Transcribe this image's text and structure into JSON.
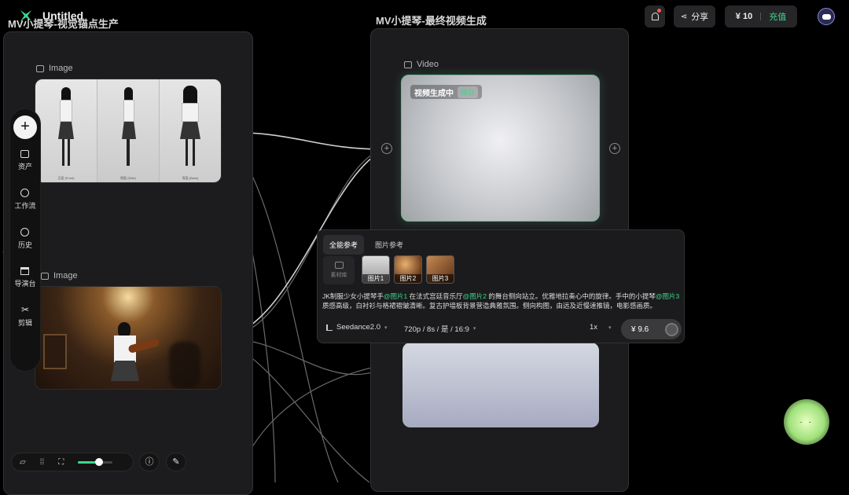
{
  "app": {
    "title": "Untitled"
  },
  "groups": {
    "left_title": "MV小提琴-视觉锚点生产",
    "right_title": "MV小提琴-最终视频生成"
  },
  "nodes": {
    "image1_label": "Image",
    "image2_label": "Image",
    "video_label": "Video",
    "video_status": "视频生成中",
    "video_status_badge": "排队",
    "sheet_captions": [
      "正面 (Front)",
      "侧面 (Side)",
      "背面 (Back)"
    ]
  },
  "header": {
    "share_label": "分享",
    "balance": "¥ 10",
    "recharge_label": "充值"
  },
  "sidebar": {
    "items": [
      {
        "label": "资产",
        "icon": "asset-box-icon"
      },
      {
        "label": "工作流",
        "icon": "workflow-icon"
      },
      {
        "label": "历史",
        "icon": "clock-icon"
      },
      {
        "label": "导演台",
        "icon": "clapper-icon"
      },
      {
        "label": "剪辑",
        "icon": "scissors-icon"
      }
    ]
  },
  "prompt_panel": {
    "tabs": [
      "全能参考",
      "图片参考"
    ],
    "material_label": "素材库",
    "thumbs": [
      "图片1",
      "图片2",
      "图片3"
    ],
    "text_parts": {
      "p1": "JK制服少女小提琴手",
      "m1": "@图片1",
      "p2": " 在法式宫廷音乐厅",
      "m2": "@图片2",
      "p3": " 的舞台侧向站立。优雅地拉奏心中的旋律。手中的小提琴",
      "m3": "@图片3",
      "p4": " 质感高级，白衬衫与格裙褶皱清晰。复古护墙板背景营造典雅氛围。侧向构图，由远及近慢速推镜，电影感画质。"
    },
    "model": "Seedance2.0",
    "settings": "720p / 8s / 是 / 16:9",
    "count": "1x",
    "cost": "¥ 9.6"
  },
  "zoom": {
    "level": 0.6
  },
  "colors": {
    "accent": "#3fd68e",
    "video_border": "#5fbf8f"
  }
}
